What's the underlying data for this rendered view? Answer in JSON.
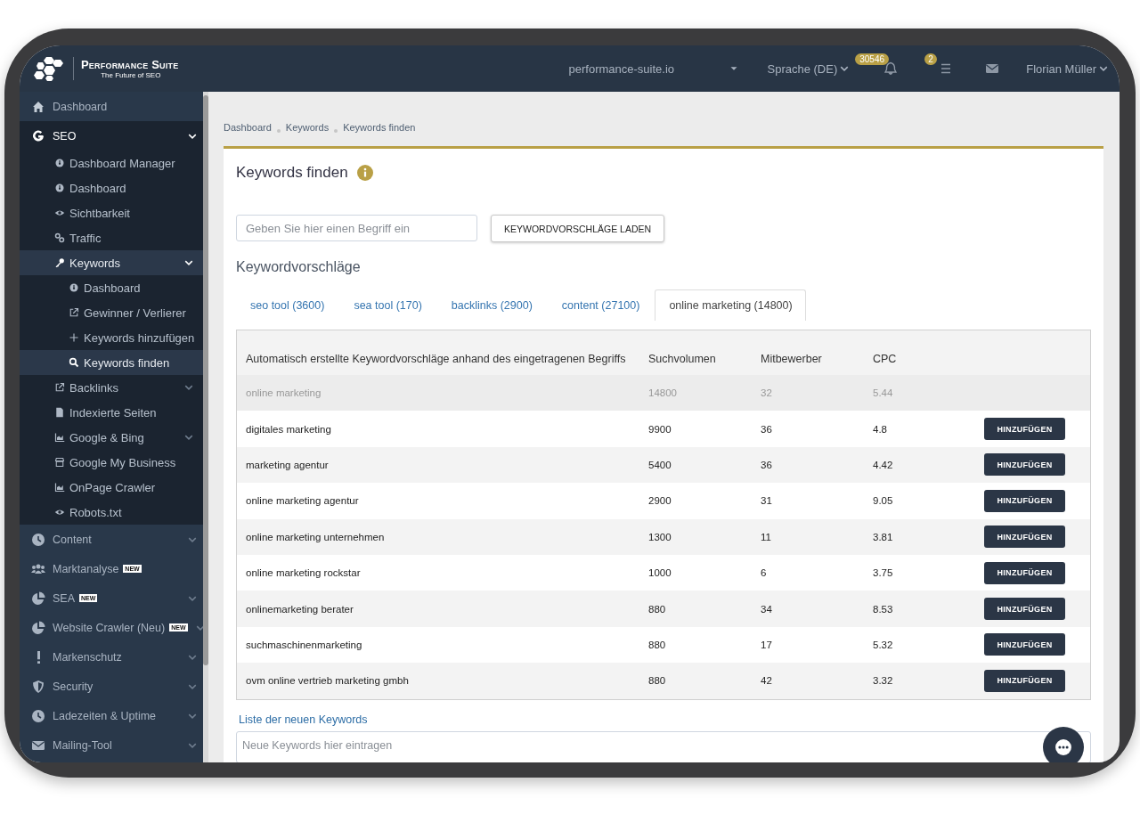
{
  "header": {
    "logo": {
      "title": "Performance Suite",
      "subtitle": "The Future of SEO"
    },
    "domain": "performance-suite.io",
    "language": "Sprache (DE)",
    "notifications": "30546",
    "tasks": "2",
    "user": "Florian Müller"
  },
  "sidebar": {
    "items": [
      {
        "label": "Dashboard",
        "selected": false
      },
      {
        "label": "SEO",
        "selected": false,
        "expanded": true,
        "children": [
          {
            "label": "Dashboard Manager",
            "selected": false
          },
          {
            "label": "Dashboard",
            "selected": false
          },
          {
            "label": "Sichtbarkeit",
            "selected": false
          },
          {
            "label": "Traffic",
            "selected": false
          },
          {
            "label": "Keywords",
            "selected": true,
            "expanded": true,
            "children": [
              {
                "label": "Dashboard",
                "selected": false
              },
              {
                "label": "Gewinner / Verlierer",
                "selected": false
              },
              {
                "label": "Keywords hinzufügen",
                "selected": false
              },
              {
                "label": "Keywords finden",
                "selected": true
              }
            ]
          },
          {
            "label": "Backlinks",
            "selected": false,
            "expanded": false
          },
          {
            "label": "Indexierte Seiten",
            "selected": false
          },
          {
            "label": "Google & Bing",
            "selected": false,
            "expanded": false
          },
          {
            "label": "Google My Business",
            "selected": false
          },
          {
            "label": "OnPage Crawler",
            "selected": false
          },
          {
            "label": "Robots.txt",
            "selected": false
          }
        ]
      },
      {
        "label": "Content",
        "selected": false,
        "expanded": false
      },
      {
        "label": "Marktanalyse",
        "selected": false,
        "badge": "NEW"
      },
      {
        "label": "SEA",
        "selected": false,
        "expanded": false,
        "badge": "NEW"
      },
      {
        "label": "Website Crawler (Neu)",
        "selected": false,
        "expanded": false,
        "badge": "NEW"
      },
      {
        "label": "Markenschutz",
        "selected": false,
        "expanded": false
      },
      {
        "label": "Security",
        "selected": false,
        "expanded": false
      },
      {
        "label": "Ladezeiten & Uptime",
        "selected": false,
        "expanded": false
      },
      {
        "label": "Mailing-Tool",
        "selected": false,
        "expanded": false
      }
    ]
  },
  "breadcrumb": [
    "Dashboard",
    "Keywords",
    "Keywords finden"
  ],
  "card": {
    "title": "Keywords finden",
    "search": {
      "placeholder": "Geben Sie hier einen Begriff ein"
    },
    "load_button": "KEYWORDVORSCHLÄGE LADEN",
    "subtitle": "Keywordvorschläge",
    "tabs": [
      {
        "label": "seo tool (3600)",
        "selected": false
      },
      {
        "label": "sea tool (170)",
        "selected": false
      },
      {
        "label": "backlinks (2900)",
        "selected": false
      },
      {
        "label": "content (27100)",
        "selected": false
      },
      {
        "label": "online marketing (14800)",
        "selected": true
      }
    ],
    "table": {
      "columns": [
        "Automatisch erstellte Keywordvorschläge anhand des eingetragenen Begriffs",
        "Suchvolumen",
        "Mitbewerber",
        "CPC"
      ],
      "rows": [
        {
          "keyword": "online marketing",
          "volume": "14800",
          "competitors": "32",
          "cpc": "5.44",
          "disabled": true
        },
        {
          "keyword": "digitales marketing",
          "volume": "9900",
          "competitors": "36",
          "cpc": "4.8",
          "disabled": false,
          "button": "HINZUFÜGEN"
        },
        {
          "keyword": "marketing agentur",
          "volume": "5400",
          "competitors": "36",
          "cpc": "4.42",
          "disabled": false,
          "button": "HINZUFÜGEN"
        },
        {
          "keyword": "online marketing agentur",
          "volume": "2900",
          "competitors": "31",
          "cpc": "9.05",
          "disabled": false,
          "button": "HINZUFÜGEN"
        },
        {
          "keyword": "online marketing unternehmen",
          "volume": "1300",
          "competitors": "11",
          "cpc": "3.81",
          "disabled": false,
          "button": "HINZUFÜGEN"
        },
        {
          "keyword": "online marketing rockstar",
          "volume": "1000",
          "competitors": "6",
          "cpc": "3.75",
          "disabled": false,
          "button": "HINZUFÜGEN"
        },
        {
          "keyword": "onlinemarketing berater",
          "volume": "880",
          "competitors": "34",
          "cpc": "8.53",
          "disabled": false,
          "button": "HINZUFÜGEN"
        },
        {
          "keyword": "suchmaschinenmarketing",
          "volume": "880",
          "competitors": "17",
          "cpc": "5.32",
          "disabled": false,
          "button": "HINZUFÜGEN"
        },
        {
          "keyword": "ovm online vertrieb marketing gmbh",
          "volume": "880",
          "competitors": "42",
          "cpc": "3.32",
          "disabled": false,
          "button": "HINZUFÜGEN"
        }
      ]
    },
    "new_keywords": {
      "label": "Liste der neuen Keywords",
      "placeholder": "Neue Keywords hier eintragen"
    }
  }
}
